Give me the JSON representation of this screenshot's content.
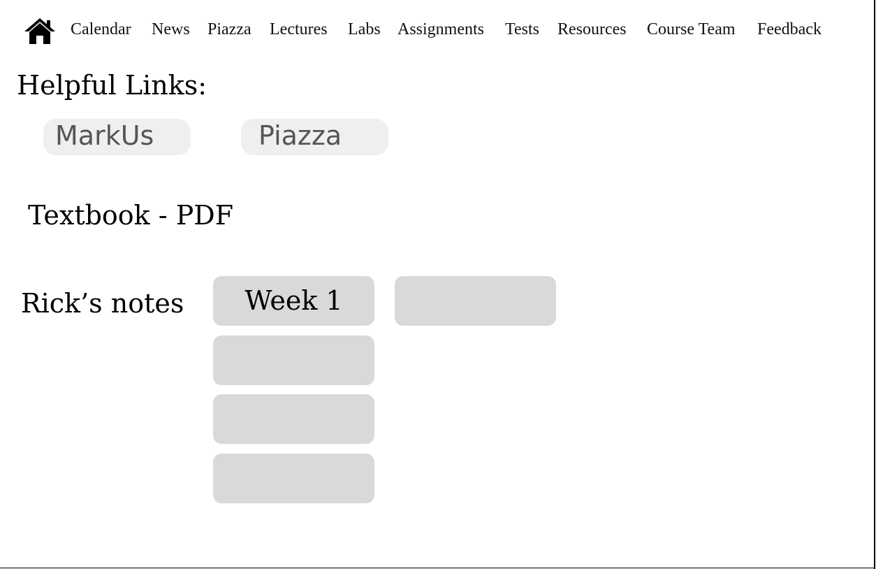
{
  "nav": {
    "home_icon": "home-icon",
    "items": [
      {
        "label": "Calendar"
      },
      {
        "label": "News"
      },
      {
        "label": "Piazza"
      },
      {
        "label": "Lectures"
      },
      {
        "label": "Labs"
      },
      {
        "label": "Assignments"
      },
      {
        "label": "Tests"
      },
      {
        "label": "Resources"
      },
      {
        "label": "Course Team"
      },
      {
        "label": "Feedback"
      }
    ]
  },
  "helpful_links": {
    "title": "Helpful Links:",
    "buttons": [
      {
        "label": "MarkUs"
      },
      {
        "label": "Piazza"
      }
    ]
  },
  "textbook": {
    "label": "Textbook - PDF"
  },
  "notes": {
    "title": "Rick’s notes",
    "weeks": [
      {
        "label": "Week 1"
      },
      {
        "label": ""
      },
      {
        "label": ""
      },
      {
        "label": ""
      },
      {
        "label": ""
      }
    ]
  },
  "colors": {
    "pill_background": "#efefef",
    "tile_background": "#d9d9d9",
    "pill_text": "#555555"
  }
}
